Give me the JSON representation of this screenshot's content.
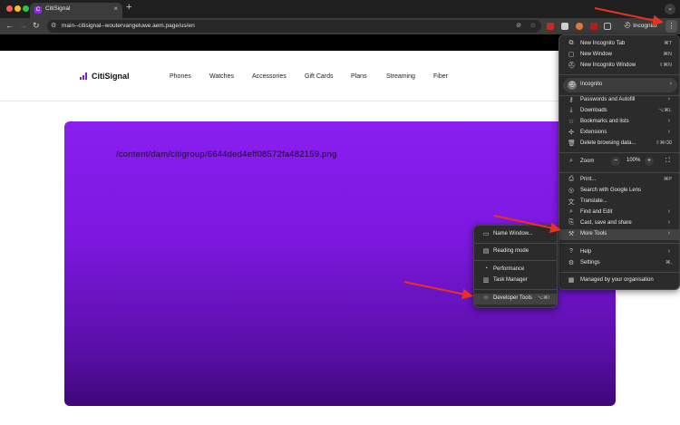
{
  "browser": {
    "tab_title": "CitiSignal",
    "tab_icon_letter": "C",
    "url": "main--citisignal--woutervangeluwe.aem.page/us/en",
    "incognito_label": "Incognito"
  },
  "site": {
    "brand": "CitiSignal",
    "nav": [
      "Phones",
      "Watches",
      "Accessories",
      "Gift Cards",
      "Plans",
      "Streaming",
      "Fiber"
    ]
  },
  "hero": {
    "path_text": "/content/dam/citigroup/6644ded4eff08572fa482159.png"
  },
  "main_menu": {
    "items": [
      {
        "label": "New Incognito Tab",
        "shortcut": "⌘T",
        "icon": "new-tab-icon"
      },
      {
        "label": "New Window",
        "shortcut": "⌘N",
        "icon": "new-window-icon"
      },
      {
        "label": "New Incognito Window",
        "shortcut": "⇧⌘N",
        "icon": "incognito-icon"
      },
      {
        "label": "Incognito",
        "icon": "profile-icon"
      },
      {
        "label": "Passwords and Autofill",
        "icon": "key-icon"
      },
      {
        "label": "Downloads",
        "shortcut": "⌥⌘L",
        "icon": "download-icon"
      },
      {
        "label": "Bookmarks and lists",
        "icon": "star-icon"
      },
      {
        "label": "Extensions",
        "icon": "puzzle-icon"
      },
      {
        "label": "Delete browsing data...",
        "shortcut": "⇧⌘⌫",
        "icon": "trash-icon"
      },
      {
        "label": "Zoom",
        "icon": "zoom-icon"
      },
      {
        "label": "Print...",
        "shortcut": "⌘P",
        "icon": "print-icon"
      },
      {
        "label": "Search with Google Lens",
        "icon": "lens-icon"
      },
      {
        "label": "Translate...",
        "icon": "translate-icon"
      },
      {
        "label": "Find and Edit",
        "icon": "find-icon"
      },
      {
        "label": "Cast, save and share",
        "icon": "cast-icon"
      },
      {
        "label": "More Tools",
        "icon": "toolbox-icon"
      },
      {
        "label": "Help",
        "icon": "help-icon"
      },
      {
        "label": "Settings",
        "shortcut": "⌘,",
        "icon": "gear-icon"
      },
      {
        "label": "Managed by your organisation",
        "icon": "building-icon"
      }
    ],
    "zoom": {
      "minus": "−",
      "value": "100%",
      "plus": "+"
    }
  },
  "sub_menu": {
    "items": [
      {
        "label": "Name Window...",
        "icon": "window-icon"
      },
      {
        "label": "Reading mode",
        "icon": "reading-icon"
      },
      {
        "label": "Performance",
        "icon": "performance-icon"
      },
      {
        "label": "Task Manager",
        "icon": "task-icon"
      },
      {
        "label": "Developer Tools",
        "shortcut": "⌥⌘I",
        "icon": "code-icon"
      }
    ]
  },
  "colors": {
    "hero_top": "#8a1ff0",
    "hero_bottom": "#3e0877",
    "arrow": "#e8321e",
    "brand_accent": "#7a1fd6"
  }
}
